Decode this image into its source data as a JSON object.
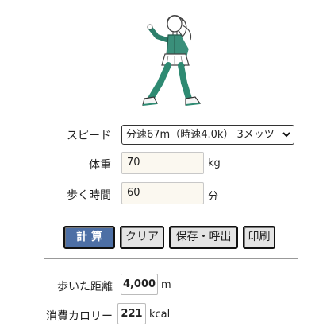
{
  "illustration": {
    "name": "walking-woman-illustration"
  },
  "form": {
    "speed": {
      "label": "スピード",
      "selected": "分速67m（時速4.0k） 3メッツ"
    },
    "weight": {
      "label": "体重",
      "value": "70",
      "unit": "kg"
    },
    "time": {
      "label": "歩く時間",
      "value": "60",
      "unit": "分"
    }
  },
  "buttons": {
    "calculate": "計算",
    "clear": "クリア",
    "save": "保存・呼出",
    "print": "印刷"
  },
  "results": {
    "distance": {
      "label": "歩いた距離",
      "value": "4,000",
      "unit": "m"
    },
    "calories": {
      "label": "消費カロリー",
      "value": "221",
      "unit": "kcal"
    }
  },
  "colors": {
    "primary_button": "#4d6fa5",
    "jacket": "#3a8f7a",
    "pants": "#2e8a72"
  }
}
